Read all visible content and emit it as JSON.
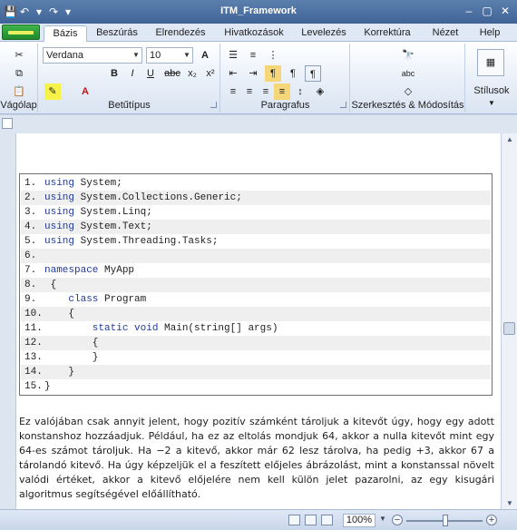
{
  "window": {
    "title": "ITM_Framework"
  },
  "quick_access": {
    "save": "💾",
    "undo": "↶",
    "redo": "↷",
    "customize": "▾"
  },
  "tabs": [
    "Bázis",
    "Beszúrás",
    "Elrendezés",
    "Hivatkozások",
    "Levelezés",
    "Korrektúra",
    "Nézet",
    "Help"
  ],
  "ribbon": {
    "groups": {
      "clipboard": "Vágólap",
      "font": "Betűtípus",
      "paragraph": "Paragrafus",
      "editing": "Szerkesztés & Módosítás",
      "styles": "Stílusok"
    },
    "font": {
      "family": "Verdana",
      "size": "10",
      "bold": "B",
      "italic": "I",
      "underline": "U",
      "strike": "abc",
      "subscript": "x₂",
      "superscript": "x²",
      "grow": "A",
      "shrink": "A"
    }
  },
  "code_lines": [
    {
      "num": "1.",
      "kw": "using",
      "rest": " System;"
    },
    {
      "num": "2.",
      "kw": "using",
      "rest": " System.Collections.Generic;"
    },
    {
      "num": "3.",
      "kw": "using",
      "rest": " System.Linq;"
    },
    {
      "num": "4.",
      "kw": "using",
      "rest": " System.Text;"
    },
    {
      "num": "5.",
      "kw": "using",
      "rest": " System.Threading.Tasks;"
    },
    {
      "num": "6.",
      "kw": "",
      "rest": ""
    },
    {
      "num": "7.",
      "kw": "namespace",
      "rest": " MyApp"
    },
    {
      "num": "8.",
      "kw": "",
      "rest": " {"
    },
    {
      "num": "9.",
      "kw": "    class",
      "rest": " Program"
    },
    {
      "num": "10.",
      "kw": "",
      "rest": "    {"
    },
    {
      "num": "11.",
      "kw": "        static void",
      "rest": " Main(string[] args)"
    },
    {
      "num": "12.",
      "kw": "",
      "rest": "        {"
    },
    {
      "num": "13.",
      "kw": "",
      "rest": "        }"
    },
    {
      "num": "14.",
      "kw": "",
      "rest": "    }"
    },
    {
      "num": "15.",
      "kw": "",
      "rest": "}"
    }
  ],
  "paragraph": "Ez valójában csak annyit jelent, hogy pozitív számként tároljuk a kitevőt úgy, hogy egy adott konstanshoz hozzáadjuk. Például, ha ez az eltolás mondjuk 64, akkor a nulla kitevőt mint egy 64-es számot tároljuk. Ha −2 a kitevő, akkor már 62 lesz tárolva, ha pedig +3, akkor 67 a tárolandó kitevő. Ha úgy képzeljük el a feszített előjeles ábrázolást, mint a konstanssal növelt valódi értéket, akkor a kitevő előjelére nem kell külön jelet pazarolni, az egy kisugári algoritmus segítségével előállítható.",
  "statusbar": {
    "zoom": "100%",
    "zoom_out": "−",
    "zoom_in": "+"
  },
  "colors": {
    "accent": "#3f6396",
    "file_button": "#2a9a39",
    "keyword": "#1f3a9a"
  }
}
